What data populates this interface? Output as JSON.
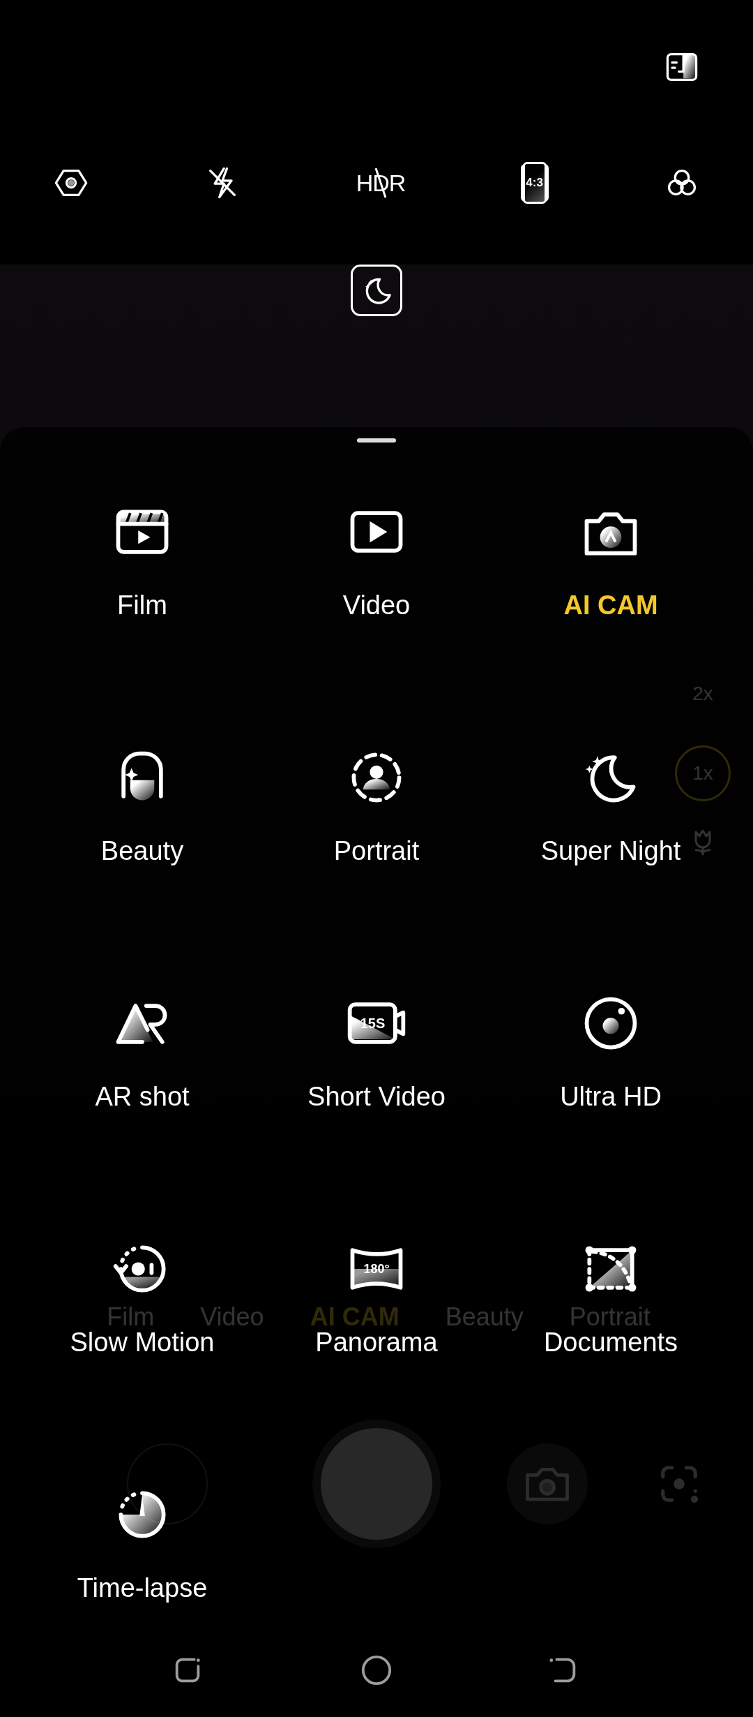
{
  "quick_settings": [
    {
      "kind": "settings"
    },
    {
      "kind": "flash",
      "on": false
    },
    {
      "kind": "hdr",
      "label": "HDR",
      "on": false
    },
    {
      "kind": "ratio",
      "label": "4:3"
    },
    {
      "kind": "filter"
    }
  ],
  "zoom_levels": [
    {
      "label": "2x",
      "selected": false
    },
    {
      "label": "1x",
      "selected": true
    }
  ],
  "mode_strip": [
    {
      "label": "Film",
      "selected": false
    },
    {
      "label": "Video",
      "selected": false
    },
    {
      "label": "AI CAM",
      "selected": true
    },
    {
      "label": "Beauty",
      "selected": false
    },
    {
      "label": "Portrait",
      "selected": false
    }
  ],
  "modes": [
    {
      "kind": "film",
      "label": "Film",
      "selected": false
    },
    {
      "kind": "video",
      "label": "Video",
      "selected": false
    },
    {
      "kind": "ai-cam",
      "label": "AI CAM",
      "selected": true
    },
    {
      "kind": "beauty",
      "label": "Beauty",
      "selected": false
    },
    {
      "kind": "portrait",
      "label": "Portrait",
      "selected": false
    },
    {
      "kind": "super-night",
      "label": "Super Night",
      "selected": false
    },
    {
      "kind": "ar",
      "label": "AR shot",
      "selected": false
    },
    {
      "kind": "short-video",
      "label": "Short Video",
      "icon_text": "15S",
      "selected": false
    },
    {
      "kind": "ultra-hd",
      "label": "Ultra HD",
      "selected": false
    },
    {
      "kind": "slow-motion",
      "label": "Slow Motion",
      "selected": false
    },
    {
      "kind": "panorama",
      "label": "Panorama",
      "icon_text": "180°",
      "selected": false
    },
    {
      "kind": "documents",
      "label": "Documents",
      "selected": false
    },
    {
      "kind": "time-lapse",
      "label": "Time-lapse",
      "selected": false
    }
  ]
}
